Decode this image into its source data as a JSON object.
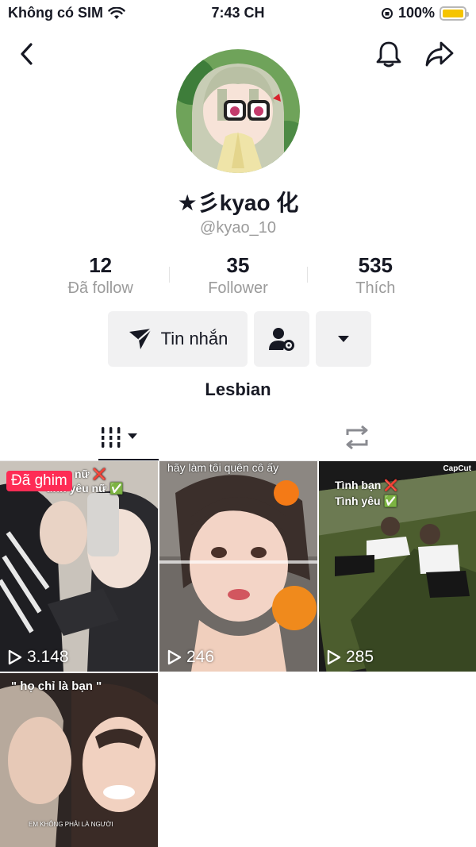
{
  "status_bar": {
    "carrier": "Không có SIM",
    "time": "7:43 CH",
    "battery": "100%",
    "battery_level": 1.0
  },
  "nav": {
    "back_icon": "chevron-left-icon",
    "bell_icon": "bell-icon",
    "share_icon": "share-arrow-icon"
  },
  "profile": {
    "display_name": "★彡kyao 化",
    "username": "@kyao_10",
    "bio": "Lesbian"
  },
  "stats": [
    {
      "value": "12",
      "label": "Đã follow"
    },
    {
      "value": "35",
      "label": "Follower"
    },
    {
      "value": "535",
      "label": "Thích"
    }
  ],
  "actions": {
    "message_label": "Tin nhắn",
    "add_friend_icon": "person-gear-icon",
    "more_icon": "caret-down-icon"
  },
  "tabs": [
    {
      "icon": "grid-icon",
      "active": true
    },
    {
      "icon": "repost-icon",
      "active": false
    }
  ],
  "videos": [
    {
      "views": "3.148",
      "pinned_label": "Đã ghim",
      "overlay": [
        "nữ ❌",
        "tình yêu nữ ✅"
      ]
    },
    {
      "views": "246",
      "overlay": [
        "hãy làm tôi quên cô ấy"
      ]
    },
    {
      "views": "285",
      "overlay": [
        "Tình bạn ❌",
        "Tình yêu ✅"
      ],
      "watermark": "CapCut"
    },
    {
      "overlay": [
        "\" họ chỉ là bạn \"",
        "EM KHÔNG PHẢI LÀ NGƯỜI"
      ]
    }
  ],
  "colors": {
    "accent": "#fe2c55",
    "text": "#161823",
    "muted": "#9b9b9b",
    "button_bg": "#f1f1f2"
  }
}
